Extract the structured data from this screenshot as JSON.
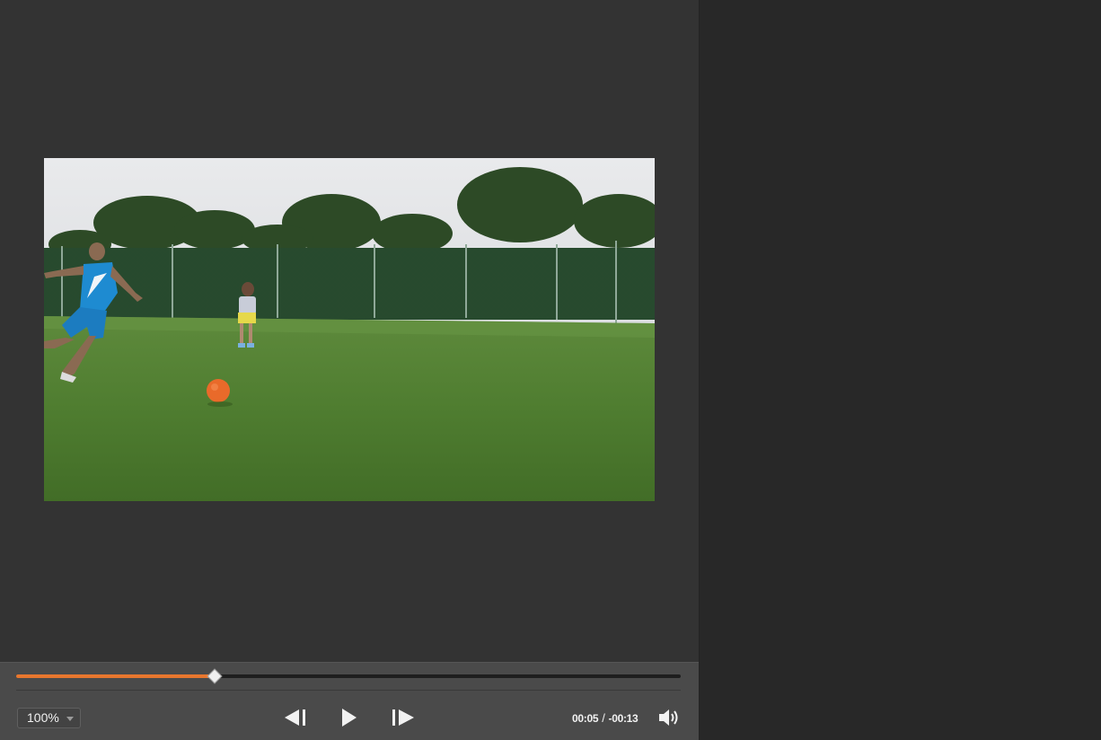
{
  "player": {
    "zoom": "100%",
    "progress_fraction": 0.298,
    "time_elapsed": "00:05",
    "time_separator": "/",
    "time_remaining": "-00:13"
  },
  "icons": {
    "prev_frame": "step-back-icon",
    "play": "play-icon",
    "next_frame": "step-forward-icon",
    "volume": "volume-icon",
    "zoom_caret": "chevron-down-icon"
  },
  "colors": {
    "accent": "#e8772e",
    "panel": "#333333",
    "controls": "#4a4a4a",
    "sidebar": "#282828"
  }
}
